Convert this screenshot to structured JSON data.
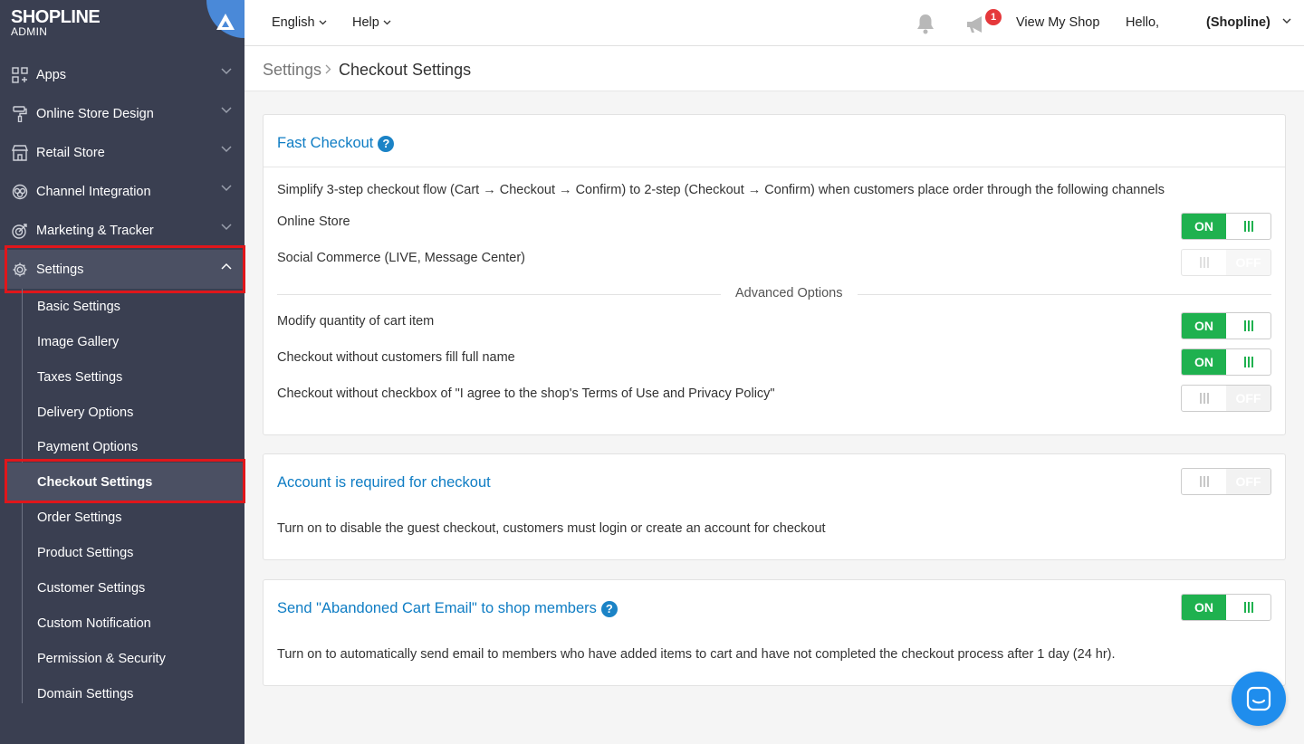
{
  "brand": {
    "name": "SHOPLINE",
    "sub": "ADMIN"
  },
  "sidebar": {
    "items": [
      {
        "label": "Apps",
        "icon": "apps-icon"
      },
      {
        "label": "Online Store Design",
        "icon": "paint-roller-icon"
      },
      {
        "label": "Retail Store",
        "icon": "store-icon"
      },
      {
        "label": "Channel Integration",
        "icon": "channel-icon"
      },
      {
        "label": "Marketing & Tracker",
        "icon": "target-icon"
      },
      {
        "label": "Settings",
        "icon": "gear-icon"
      }
    ],
    "sub_items": [
      "Basic Settings",
      "Image Gallery",
      "Taxes Settings",
      "Delivery Options",
      "Payment Options",
      "Checkout Settings",
      "Order Settings",
      "Product Settings",
      "Customer Settings",
      "Custom Notification",
      "Permission & Security",
      "Domain Settings"
    ]
  },
  "topbar": {
    "language": "English",
    "help": "Help",
    "notification_count": "1",
    "view_shop": "View My Shop",
    "hello": "Hello,",
    "user": "(Shopline)"
  },
  "breadcrumb": {
    "root": "Settings",
    "current": "Checkout Settings"
  },
  "fast_checkout": {
    "title": "Fast Checkout",
    "description": "Simplify 3-step checkout flow (Cart → Checkout → Confirm) to 2-step (Checkout → Confirm) when customers place order through the following channels",
    "rows": [
      {
        "label": "Online Store",
        "state": "ON"
      },
      {
        "label": "Social Commerce (LIVE, Message Center)",
        "state": "OFF"
      }
    ],
    "advanced_label": "Advanced Options",
    "advanced_rows": [
      {
        "label": "Modify quantity of cart item",
        "state": "ON"
      },
      {
        "label": "Checkout without customers fill full name",
        "state": "ON"
      },
      {
        "label": "Checkout without checkbox of \"I agree to the shop's Terms of Use and Privacy Policy\"",
        "state": "OFF"
      }
    ]
  },
  "account_required": {
    "title": "Account is required for checkout",
    "state": "OFF",
    "description": "Turn on to disable the guest checkout, customers must login or create an account for checkout"
  },
  "abandoned_cart": {
    "title": "Send \"Abandoned Cart Email\" to shop members",
    "state": "ON",
    "description": "Turn on to automatically send email to members who have added items to cart and have not completed the checkout process after 1 day (24 hr)."
  },
  "help_icon_glyph": "?",
  "colors": {
    "sidebar": "#3a3f51",
    "accent": "#0f7dc4",
    "on": "#1fb14f",
    "highlight": "#e0161b",
    "chat": "#1f8ded"
  }
}
